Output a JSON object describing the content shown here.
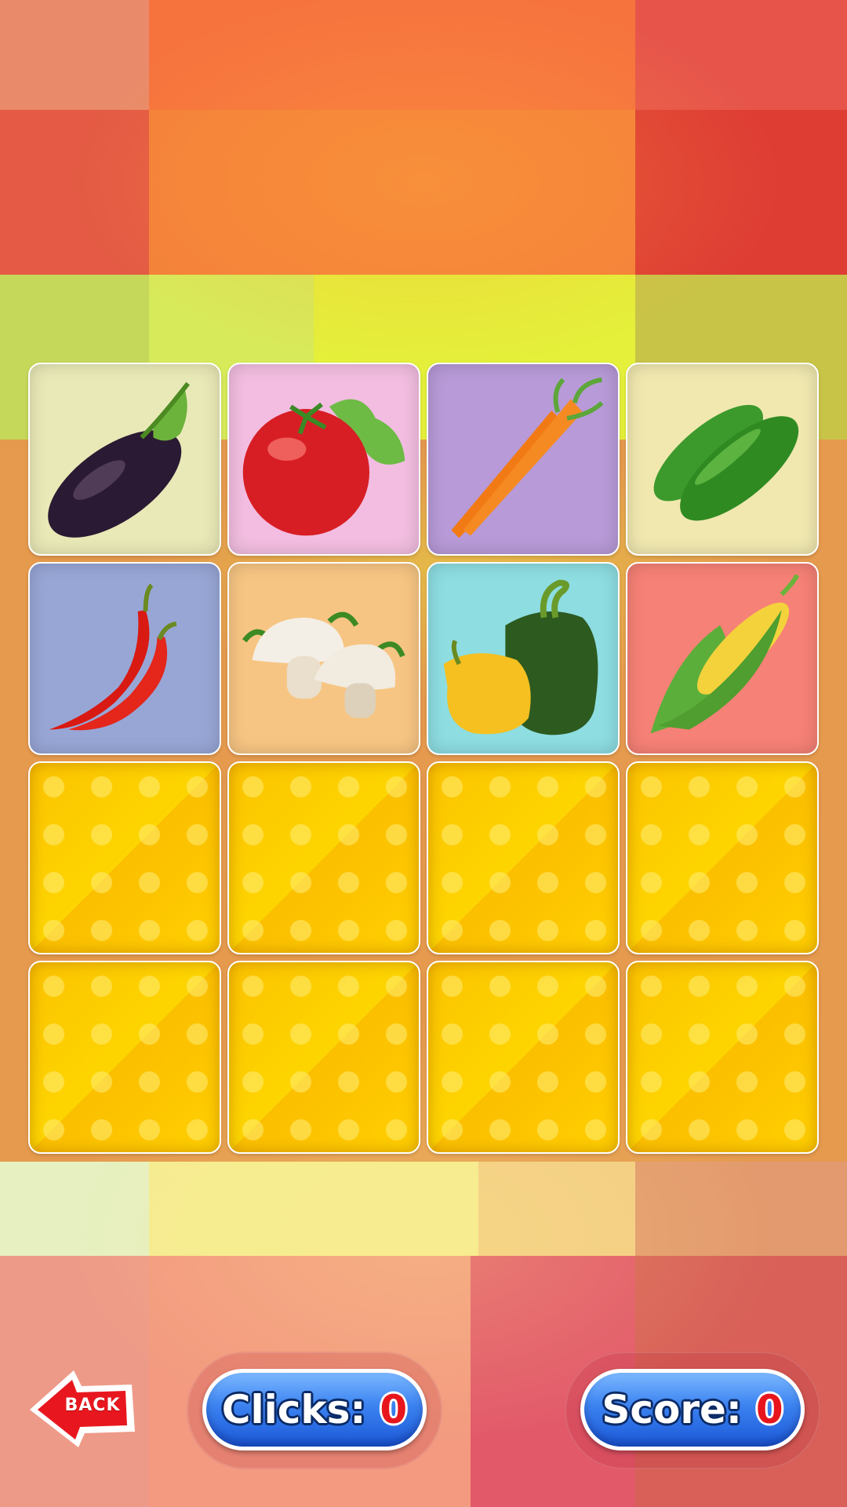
{
  "game": {
    "cards": [
      {
        "state": "face",
        "item": "eggplant",
        "icon": "eggplant-icon",
        "bg": "#e9e9b7"
      },
      {
        "state": "face",
        "item": "tomato",
        "icon": "tomato-icon",
        "bg": "#f2bde0"
      },
      {
        "state": "face",
        "item": "carrot",
        "icon": "carrot-icon",
        "bg": "#b79ad7"
      },
      {
        "state": "face",
        "item": "cucumber",
        "icon": "cucumber-icon",
        "bg": "#f1e8b0"
      },
      {
        "state": "face",
        "item": "chili-pepper",
        "icon": "chili-pepper-icon",
        "bg": "#98a6d6"
      },
      {
        "state": "face",
        "item": "mushroom",
        "icon": "mushroom-icon",
        "bg": "#f7c583"
      },
      {
        "state": "face",
        "item": "bell-pepper",
        "icon": "bell-pepper-icon",
        "bg": "#8ddde1"
      },
      {
        "state": "face",
        "item": "corn",
        "icon": "corn-icon",
        "bg": "#f68176"
      },
      {
        "state": "back"
      },
      {
        "state": "back"
      },
      {
        "state": "back"
      },
      {
        "state": "back"
      },
      {
        "state": "back"
      },
      {
        "state": "back"
      },
      {
        "state": "back"
      },
      {
        "state": "back"
      }
    ]
  },
  "controls": {
    "back_label": "BACK",
    "clicks_label": "Clicks:",
    "clicks_value": "0",
    "score_label": "Score:",
    "score_value": "0"
  },
  "colors": {
    "card_back": "#fcc300",
    "pill_blue": "#3b82f0",
    "counter_red": "#e8151d",
    "back_arrow_red": "#e8171f"
  }
}
